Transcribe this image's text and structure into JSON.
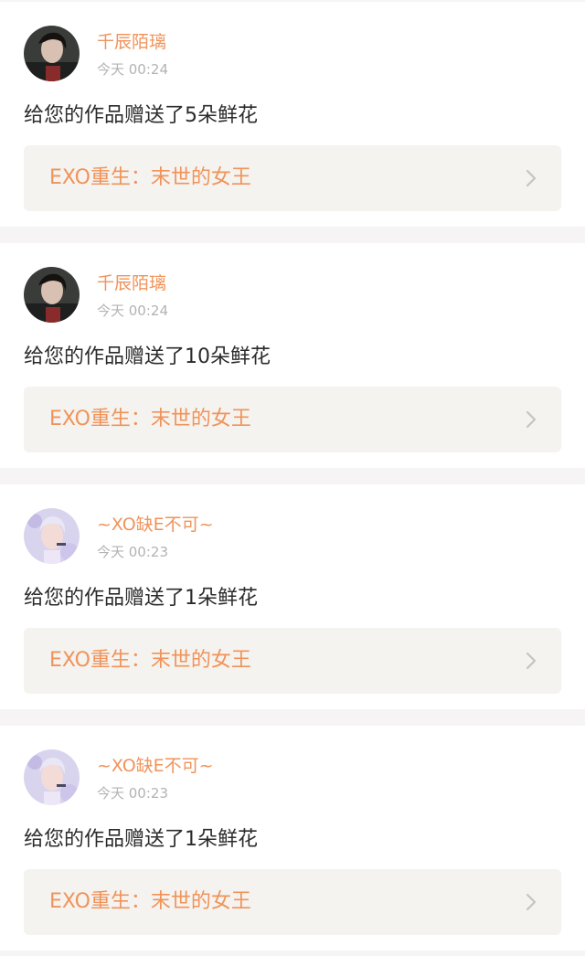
{
  "notifications": [
    {
      "username": "千辰陌璃",
      "time": "今天 00:24",
      "message": "给您的作品赠送了5朵鲜花",
      "book_title": "EXO重生：末世的女王",
      "avatar": "avatar-dark-portrait"
    },
    {
      "username": "千辰陌璃",
      "time": "今天 00:24",
      "message": "给您的作品赠送了10朵鲜花",
      "book_title": "EXO重生：末世的女王",
      "avatar": "avatar-dark-portrait"
    },
    {
      "username": "~XO缺E不可~",
      "time": "今天 00:23",
      "message": "给您的作品赠送了1朵鲜花",
      "book_title": "EXO重生：末世的女王",
      "avatar": "avatar-light-portrait"
    },
    {
      "username": "~XO缺E不可~",
      "time": "今天 00:23",
      "message": "给您的作品赠送了1朵鲜花",
      "book_title": "EXO重生：末世的女王",
      "avatar": "avatar-light-portrait"
    }
  ],
  "icons": {
    "chevron": "chevron-right-icon"
  },
  "colors": {
    "accent": "#f0935a",
    "link_background": "#f5f3ef",
    "page_background": "#f6f4f4",
    "timestamp": "#b3b3b3",
    "message_text": "#2b2b2b"
  }
}
